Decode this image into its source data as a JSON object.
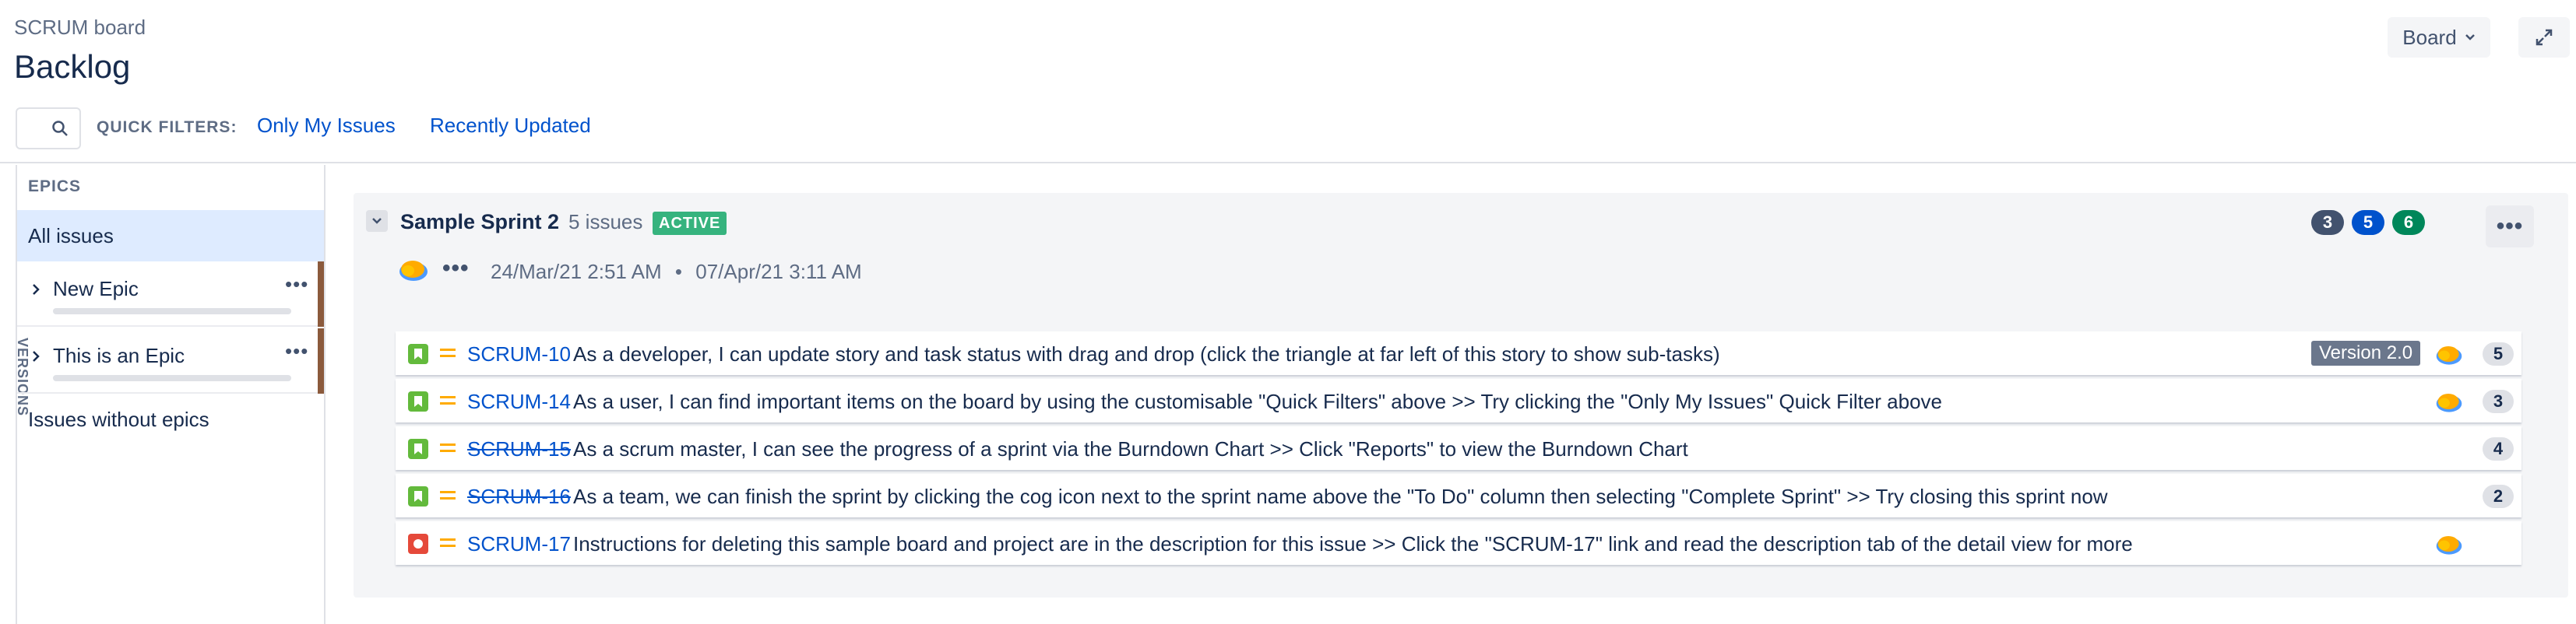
{
  "header": {
    "breadcrumb": "SCRUM board",
    "title": "Backlog",
    "board_button": "Board",
    "expand_icon": "expand-icon"
  },
  "filters": {
    "search_icon": "search-icon",
    "quick_filters_label": "QUICK FILTERS:",
    "items": [
      "Only My Issues",
      "Recently Updated"
    ]
  },
  "sidebar": {
    "versions_label": "VERSIONS",
    "epics_label": "EPICS",
    "all_issues": "All issues",
    "epics": [
      {
        "name": "New Epic",
        "color": "#8b5a3c"
      },
      {
        "name": "This is an Epic",
        "color": "#8b5a3c"
      }
    ],
    "issues_without_epics": "Issues without epics"
  },
  "sprint": {
    "name": "Sample Sprint 2",
    "issue_count": "5 issues",
    "status": "ACTIVE",
    "start": "24/Mar/21 2:51 AM",
    "separator": "•",
    "end": "07/Apr/21 3:11 AM",
    "counts": {
      "todo": "3",
      "in_progress": "5",
      "done": "6"
    },
    "colors": {
      "todo": "#42526e",
      "in_progress": "#0052cc",
      "done": "#00875a",
      "active": "#36b37e"
    }
  },
  "issues": [
    {
      "key": "SCRUM-10",
      "type": "story",
      "done": false,
      "summary": "As a developer, I can update story and task status with drag and drop (click the triangle at far left of this story to show sub-tasks)",
      "version": "Version 2.0",
      "assignee": true,
      "points": "5"
    },
    {
      "key": "SCRUM-14",
      "type": "story",
      "done": false,
      "summary": "As a user, I can find important items on the board by using the customisable \"Quick Filters\" above >> Try clicking the \"Only My Issues\" Quick Filter above",
      "version": "",
      "assignee": true,
      "points": "3"
    },
    {
      "key": "SCRUM-15",
      "type": "story",
      "done": true,
      "summary": "As a scrum master, I can see the progress of a sprint via the Burndown Chart >> Click \"Reports\" to view the Burndown Chart",
      "version": "",
      "assignee": false,
      "points": "4"
    },
    {
      "key": "SCRUM-16",
      "type": "story",
      "done": true,
      "summary": "As a team, we can finish the sprint by clicking the cog icon next to the sprint name above the \"To Do\" column then selecting \"Complete Sprint\" >> Try closing this sprint now",
      "version": "",
      "assignee": false,
      "points": "2"
    },
    {
      "key": "SCRUM-17",
      "type": "bug",
      "done": false,
      "summary": "Instructions for deleting this sample board and project are in the description for this issue >> Click the \"SCRUM-17\" link and read the description tab of the detail view for more",
      "version": "",
      "assignee": true,
      "points": ""
    }
  ]
}
